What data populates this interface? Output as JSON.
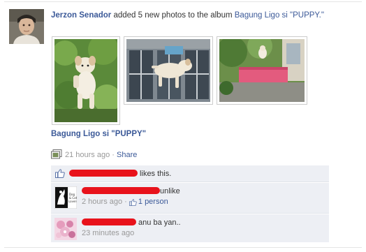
{
  "story": {
    "actor": "Jerzon Senador",
    "action_text": " added 5 new photos to the album ",
    "album_title_quoted": "Bagung Ligo si \"PUPPY.\""
  },
  "album": {
    "link_label": "Bagung Ligo si \"PUPPY\""
  },
  "meta": {
    "time": "21 hours ago",
    "separator": " · ",
    "share_label": "Share"
  },
  "likes": {
    "text": " likes this."
  },
  "comments": [
    {
      "text": "unlike",
      "time": "2 hours ago",
      "separator": " · ",
      "like_count": "1 person",
      "avatar_caption": "Dog & Cat Lovers"
    },
    {
      "text": " anu ba yan..",
      "time": "23 minutes ago"
    }
  ],
  "colors": {
    "link": "#3b5998",
    "ufi_background": "#edeff4",
    "redaction": "#e8121b"
  },
  "icons": [
    "album-icon",
    "like-thumb-icon"
  ]
}
